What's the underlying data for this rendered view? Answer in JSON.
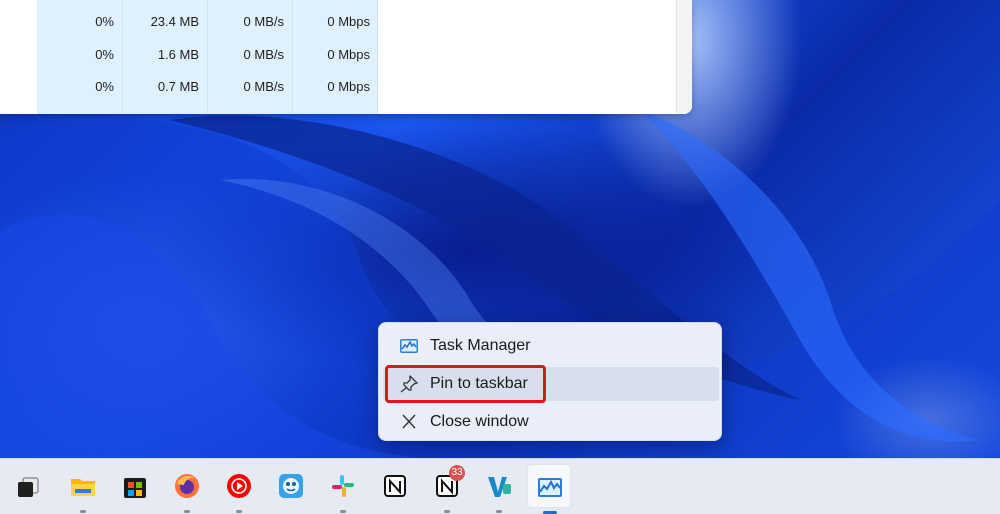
{
  "task_manager": {
    "rows": [
      {
        "cpu": "0%",
        "memory": "23.4 MB",
        "disk": "0 MB/s",
        "network": "0 Mbps"
      },
      {
        "cpu": "0%",
        "memory": "1.6 MB",
        "disk": "0 MB/s",
        "network": "0 Mbps"
      },
      {
        "cpu": "0%",
        "memory": "0.7 MB",
        "disk": "0 MB/s",
        "network": "0 Mbps"
      }
    ]
  },
  "context_menu": {
    "items": [
      {
        "label": "Task Manager",
        "icon": "task-manager-icon"
      },
      {
        "label": "Pin to taskbar",
        "icon": "pin-icon",
        "highlighted": true
      },
      {
        "label": "Close window",
        "icon": "close-icon"
      }
    ]
  },
  "taskbar": {
    "apps": [
      {
        "name": "task-view",
        "icon": "task-view-icon"
      },
      {
        "name": "file-explorer",
        "icon": "folder-icon"
      },
      {
        "name": "microsoft-store",
        "icon": "store-icon"
      },
      {
        "name": "firefox",
        "icon": "firefox-icon"
      },
      {
        "name": "youtube-music",
        "icon": "youtube-music-icon"
      },
      {
        "name": "photo-app",
        "icon": "photo-app-icon"
      },
      {
        "name": "slack",
        "icon": "slack-icon"
      },
      {
        "name": "notion",
        "icon": "notion-icon"
      },
      {
        "name": "notion-mail",
        "icon": "notion-badge-icon",
        "badge": "33"
      },
      {
        "name": "vs-app",
        "icon": "vs-app-icon"
      },
      {
        "name": "task-manager",
        "icon": "task-manager-icon",
        "active": true
      }
    ]
  },
  "colors": {
    "highlight": "#e0141c",
    "accent": "#1a6fd6"
  }
}
